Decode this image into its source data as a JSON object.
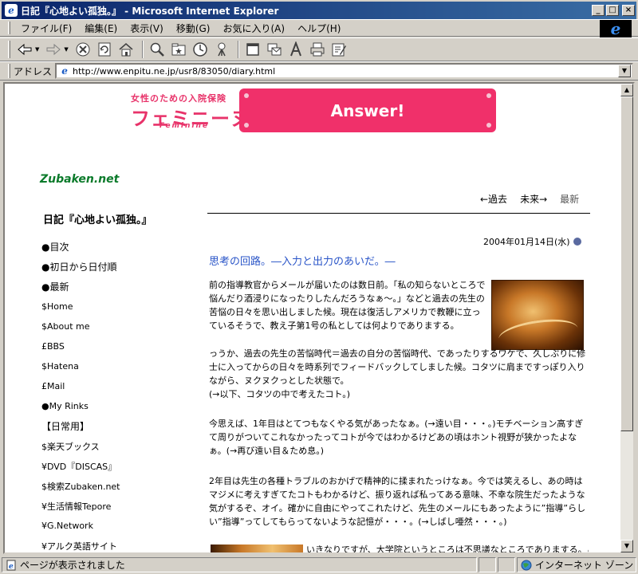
{
  "window": {
    "title": "日記『心地よい孤独。』 - Microsoft Internet Explorer"
  },
  "menu": [
    "ファイル(F)",
    "編集(E)",
    "表示(V)",
    "移動(G)",
    "お気に入り(A)",
    "ヘルプ(H)"
  ],
  "address": {
    "label": "アドレス",
    "url": "http://www.enpitu.ne.jp/usr8/83050/diary.html"
  },
  "banner": {
    "brand_sub": "女性のための入院保険",
    "brand": "フェミニーヌ",
    "brand_en": "Feminine",
    "cta": "Answer!"
  },
  "sidebar": {
    "logo": "Zubaken.net",
    "diary_title": "日記『心地よい孤独。』",
    "items": [
      "●目次",
      "●初日から日付順",
      "●最新",
      "$Home",
      "$About me",
      "£BBS",
      "$Hatena",
      "£Mail",
      "●My Rinks",
      "【日常用】",
      "$楽天ブックス",
      "¥DVD『DISCAS』",
      "$検索Zubaken.net",
      "¥生活情報Tepore",
      "¥G.Network",
      "¥アルク英語サイト"
    ]
  },
  "pager": {
    "prev": "←過去",
    "next": "未来→",
    "latest": "最新"
  },
  "entry": {
    "date": "2004年01月14日(水)",
    "title": "思考の回路。―入力と出力のあいだ。―",
    "paragraphs": [
      "前の指導教官からメールが届いたのは数日前。「私の知らないところで悩んだり酒浸りになったりしたんだろうなぁ〜。」などと過去の先生の苦悩の日々を思い出しました候。現在は復活しアメリカで教鞭に立っているそうで、教え子第1号の私としては何よりでありまする。",
      "っうか、過去の先生の苦悩時代＝過去の自分の苦悩時代、であったりするワケで、久しぶりに修士に入ってからの日々を時系列でフィードバックしてしました候。コタツに肩まですっぽり入りながら、ヌクヌクっとした状態で。\n(→以下、コタツの中で考えたコト。)",
      "今思えば、1年目はとてつもなくやる気があったなぁ。(→遠い目・・・。)モチベーション高すぎて周りがついてこれなかったってコトが今ではわかるけどあの頃はホント視野が狭かったよなぁ。(→再び遠い目＆ため息。)",
      "2年目は先生の各種トラブルのおかげで精神的に揉まれたっけなぁ。今では笑えるし、あの時はマジメに考えすぎてたコトもわかるけど、振り返れば私ってある意味、不幸な院生だったような気がするぞ、オイ。確かに自由にやってこれたけど、先生のメールにもあったように”指導”らしい”指導”ってしてもらってないような記憶が・・・。(→しばし唖然・・・。)",
      "いきなりですが、大学院というところは不思議なところでありまする。こ"
    ]
  },
  "status": {
    "text": "ページが表示されました",
    "zone": "インターネット ゾーン"
  },
  "icons": [
    "ie-logo-icon",
    "back-arrow-icon",
    "forward-arrow-icon",
    "stop-icon",
    "refresh-icon",
    "home-icon",
    "search-icon",
    "favorites-icon",
    "history-icon",
    "mail-icon",
    "print-icon",
    "edit-icon"
  ]
}
